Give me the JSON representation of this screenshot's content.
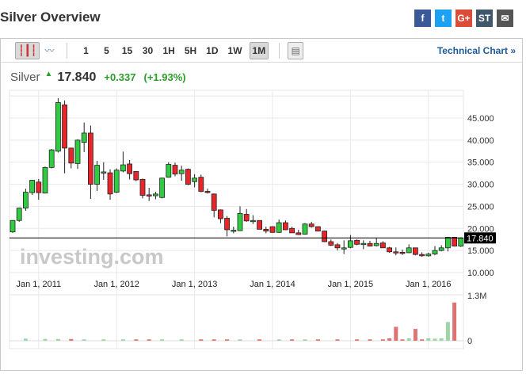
{
  "header": {
    "title": "Silver Overview"
  },
  "social": [
    {
      "icon": "facebook-icon",
      "label": "f",
      "color": "#3b5998"
    },
    {
      "icon": "twitter-icon",
      "label": "t",
      "color": "#1da1f2"
    },
    {
      "icon": "google-plus-icon",
      "label": "G+",
      "color": "#dd4b39"
    },
    {
      "icon": "stocktwits-icon",
      "label": "ST",
      "color": "#40576c"
    },
    {
      "icon": "email-icon",
      "label": "✉",
      "color": "#555"
    }
  ],
  "toolbar": {
    "intervals": [
      "1",
      "5",
      "15",
      "30",
      "1H",
      "5H",
      "1D",
      "1W",
      "1M"
    ],
    "selected": "1M",
    "technical_chart": "Technical Chart »"
  },
  "quote": {
    "name": "Silver",
    "price": "17.840",
    "change": "+0.337",
    "change_pct": "(+1.93%)"
  },
  "watermark": "investing.com",
  "colors": {
    "up": "#2ecc40",
    "down": "#e8262a",
    "vol_up": "#9fd4a6",
    "vol_down": "#dd7373"
  },
  "chart_data": {
    "type": "candlestick",
    "start_month": "2010-09",
    "interval": "1M",
    "x_tick_labels": [
      "Jan 1, 2011",
      "Jan 1, 2012",
      "Jan 1, 2013",
      "Jan 1, 2014",
      "Jan 1, 2015",
      "Jan 1, 2016"
    ],
    "y_tick_labels": [
      "10.000",
      "15.000",
      "20.000",
      "25.000",
      "30.000",
      "35.000",
      "40.000",
      "45.000"
    ],
    "ylim": [
      7,
      51
    ],
    "current_price": 17.84,
    "current_label": "17.840",
    "ohlc": [
      [
        19.2,
        21.9,
        19.0,
        21.8
      ],
      [
        21.8,
        24.7,
        21.5,
        24.6
      ],
      [
        24.6,
        29.0,
        24.0,
        28.2
      ],
      [
        28.1,
        31.0,
        27.6,
        30.9
      ],
      [
        30.5,
        31.2,
        26.5,
        28.1
      ],
      [
        28.0,
        34.0,
        27.9,
        33.8
      ],
      [
        33.8,
        38.0,
        33.6,
        37.8
      ],
      [
        37.5,
        49.5,
        37.2,
        48.5
      ],
      [
        48.0,
        49.0,
        32.5,
        38.2
      ],
      [
        38.2,
        38.3,
        33.6,
        34.8
      ],
      [
        34.7,
        40.2,
        33.5,
        40.0
      ],
      [
        39.5,
        44.0,
        37.3,
        41.6
      ],
      [
        41.6,
        43.3,
        26.7,
        30.0
      ],
      [
        30.0,
        35.3,
        28.5,
        34.3
      ],
      [
        32.6,
        35.0,
        31.0,
        32.8
      ],
      [
        32.6,
        33.4,
        26.5,
        27.8
      ],
      [
        28.2,
        33.6,
        28.0,
        33.2
      ],
      [
        33.0,
        37.4,
        32.7,
        34.4
      ],
      [
        34.6,
        35.5,
        31.1,
        32.4
      ],
      [
        32.9,
        33.0,
        30.7,
        31.0
      ],
      [
        31.1,
        31.3,
        26.8,
        27.5
      ],
      [
        27.6,
        29.2,
        26.2,
        27.4
      ],
      [
        27.4,
        28.3,
        26.6,
        27.8
      ],
      [
        27.0,
        31.5,
        26.8,
        31.4
      ],
      [
        31.6,
        35.0,
        31.5,
        34.5
      ],
      [
        34.3,
        34.9,
        31.8,
        32.3
      ],
      [
        32.4,
        34.2,
        30.8,
        33.2
      ],
      [
        33.4,
        33.6,
        29.8,
        30.0
      ],
      [
        30.6,
        32.3,
        29.3,
        31.4
      ],
      [
        31.6,
        32.2,
        28.2,
        28.4
      ],
      [
        28.4,
        29.0,
        27.9,
        28.2
      ],
      [
        27.8,
        27.9,
        22.5,
        24.1
      ],
      [
        24.2,
        24.3,
        21.2,
        22.2
      ],
      [
        22.3,
        22.8,
        18.2,
        19.7
      ],
      [
        19.5,
        20.4,
        18.9,
        19.6
      ],
      [
        19.5,
        25.0,
        19.4,
        23.4
      ],
      [
        23.2,
        24.4,
        21.5,
        21.7
      ],
      [
        21.7,
        23.0,
        21.0,
        21.8
      ],
      [
        21.8,
        21.8,
        19.8,
        19.8
      ],
      [
        19.8,
        20.4,
        18.9,
        19.4
      ],
      [
        20.4,
        20.5,
        19.0,
        19.1
      ],
      [
        19.1,
        22.0,
        19.0,
        21.3
      ],
      [
        21.3,
        21.8,
        19.6,
        19.7
      ],
      [
        20.0,
        20.4,
        19.0,
        19.0
      ],
      [
        19.0,
        19.7,
        18.5,
        18.6
      ],
      [
        18.7,
        21.2,
        18.6,
        21.0
      ],
      [
        21.0,
        21.5,
        20.2,
        20.4
      ],
      [
        20.4,
        20.5,
        19.3,
        19.4
      ],
      [
        19.4,
        19.5,
        16.9,
        17.0
      ],
      [
        17.0,
        17.5,
        16.0,
        16.2
      ],
      [
        16.3,
        16.7,
        15.0,
        15.6
      ],
      [
        15.5,
        17.3,
        14.2,
        15.6
      ],
      [
        15.7,
        18.5,
        15.5,
        17.2
      ],
      [
        17.3,
        17.5,
        16.2,
        16.4
      ],
      [
        16.6,
        17.3,
        15.3,
        16.6
      ],
      [
        16.6,
        17.2,
        15.9,
        16.0
      ],
      [
        16.1,
        17.8,
        15.9,
        16.6
      ],
      [
        16.7,
        17.1,
        15.6,
        15.6
      ],
      [
        15.6,
        15.8,
        14.5,
        14.7
      ],
      [
        14.7,
        15.7,
        13.9,
        14.6
      ],
      [
        14.6,
        15.2,
        14.0,
        14.5
      ],
      [
        14.5,
        16.4,
        14.4,
        15.6
      ],
      [
        15.6,
        15.6,
        13.9,
        14.1
      ],
      [
        14.1,
        14.6,
        13.6,
        13.8
      ],
      [
        13.8,
        14.5,
        13.6,
        14.2
      ],
      [
        14.2,
        16.0,
        13.9,
        15.0
      ],
      [
        15.0,
        16.2,
        14.8,
        15.6
      ],
      [
        15.6,
        18.1,
        14.8,
        18.0
      ],
      [
        18.0,
        18.0,
        15.9,
        16.0
      ],
      [
        16.0,
        18.0,
        15.8,
        17.84
      ]
    ],
    "volume_labels": [
      "1.3M",
      "0"
    ],
    "volume_max": 1.3,
    "volume_m": [
      0,
      0,
      0.06,
      0,
      0,
      0.05,
      0,
      0.05,
      0,
      0.05,
      0,
      0.04,
      0,
      0,
      0.04,
      0,
      0,
      0.04,
      0,
      0.04,
      0,
      0.04,
      0,
      0.04,
      0,
      0,
      0.04,
      0,
      0,
      0.04,
      0,
      0.04,
      0,
      0.04,
      0,
      0.04,
      0,
      0,
      0.04,
      0,
      0,
      0.04,
      0,
      0.04,
      0,
      0.04,
      0,
      0.04,
      0,
      0,
      0.04,
      0,
      0,
      0.04,
      0,
      0.04,
      0,
      0.04,
      0.07,
      0.4,
      0.04,
      0.07,
      0.34,
      0.04,
      0.07,
      0.06,
      0.07,
      0.54,
      1.1,
      0
    ]
  }
}
